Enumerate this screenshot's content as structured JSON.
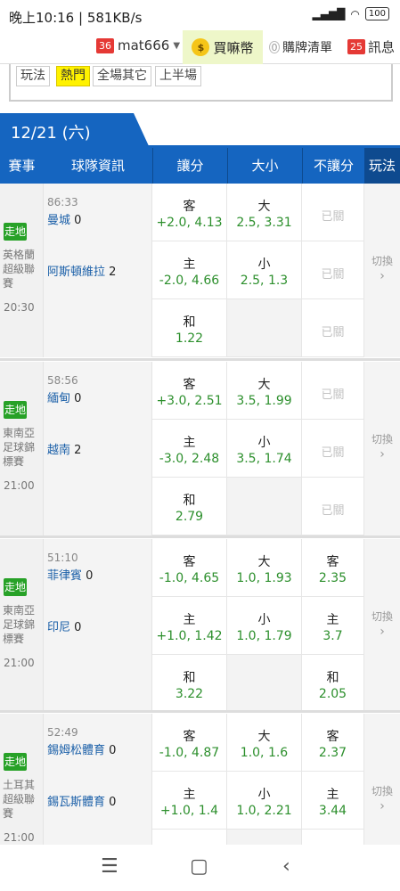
{
  "status": {
    "time": "晚上10:16 | 581KB/s",
    "battery": "100"
  },
  "topbar": {
    "cart_count_badge": "36",
    "account": "mat666",
    "buy_label": "買嘛幣",
    "cart_zero": "0",
    "cart_label": "購牌清單",
    "msg_count": "25",
    "msg_label": "訊息"
  },
  "filters": [
    "玩法",
    "熱門",
    "全場其它",
    "上半場"
  ],
  "date_tab": "12/21 (六)",
  "columns": [
    "賽事",
    "球隊資訊",
    "讓分",
    "大小",
    "不讓分",
    "玩法"
  ],
  "switch_label": "切換",
  "live_label": "走地",
  "closed_label": "已關",
  "matches": [
    {
      "league": "英格蘭超級聯賽",
      "kickoff": "20:30",
      "clock": "86:33",
      "away": {
        "name": "曼城",
        "score": "0"
      },
      "home": {
        "name": "阿斯頓維拉",
        "score": "2"
      },
      "spread": [
        {
          "label": "客",
          "value": "+2.0, 4.13"
        },
        {
          "label": "主",
          "value": "-2.0, 4.66"
        },
        {
          "label": "和",
          "value": "1.22"
        }
      ],
      "ou": [
        {
          "label": "大",
          "value": "2.5, 3.31"
        },
        {
          "label": "小",
          "value": "2.5, 1.3"
        }
      ],
      "ml": []
    },
    {
      "league": "東南亞足球錦標賽",
      "kickoff": "21:00",
      "clock": "58:56",
      "away": {
        "name": "緬甸",
        "score": "0"
      },
      "home": {
        "name": "越南",
        "score": "2"
      },
      "spread": [
        {
          "label": "客",
          "value": "+3.0, 2.51"
        },
        {
          "label": "主",
          "value": "-3.0, 2.48"
        },
        {
          "label": "和",
          "value": "2.79"
        }
      ],
      "ou": [
        {
          "label": "大",
          "value": "3.5, 1.99"
        },
        {
          "label": "小",
          "value": "3.5, 1.74"
        }
      ],
      "ml": []
    },
    {
      "league": "東南亞足球錦標賽",
      "kickoff": "21:00",
      "clock": "51:10",
      "away": {
        "name": "菲律賓",
        "score": "0"
      },
      "home": {
        "name": "印尼",
        "score": "0"
      },
      "spread": [
        {
          "label": "客",
          "value": "-1.0, 4.65"
        },
        {
          "label": "主",
          "value": "+1.0, 1.42"
        },
        {
          "label": "和",
          "value": "3.22"
        }
      ],
      "ou": [
        {
          "label": "大",
          "value": "1.0, 1.93"
        },
        {
          "label": "小",
          "value": "1.0, 1.79"
        }
      ],
      "ml": [
        {
          "label": "客",
          "value": "2.35"
        },
        {
          "label": "主",
          "value": "3.7"
        },
        {
          "label": "和",
          "value": "2.05"
        }
      ]
    },
    {
      "league": "土耳其超級聯賽",
      "kickoff": "21:00",
      "clock": "52:49",
      "away": {
        "name": "錫姆松體育",
        "score": "0"
      },
      "home": {
        "name": "錫瓦斯體育",
        "score": "0"
      },
      "spread": [
        {
          "label": "客",
          "value": "-1.0, 4.87"
        },
        {
          "label": "主",
          "value": "+1.0, 1.4"
        }
      ],
      "ou": [
        {
          "label": "大",
          "value": "1.0, 1.6"
        },
        {
          "label": "小",
          "value": "1.0, 2.21"
        }
      ],
      "ml": [
        {
          "label": "客",
          "value": "2.37"
        },
        {
          "label": "主",
          "value": "3.44"
        }
      ]
    }
  ]
}
